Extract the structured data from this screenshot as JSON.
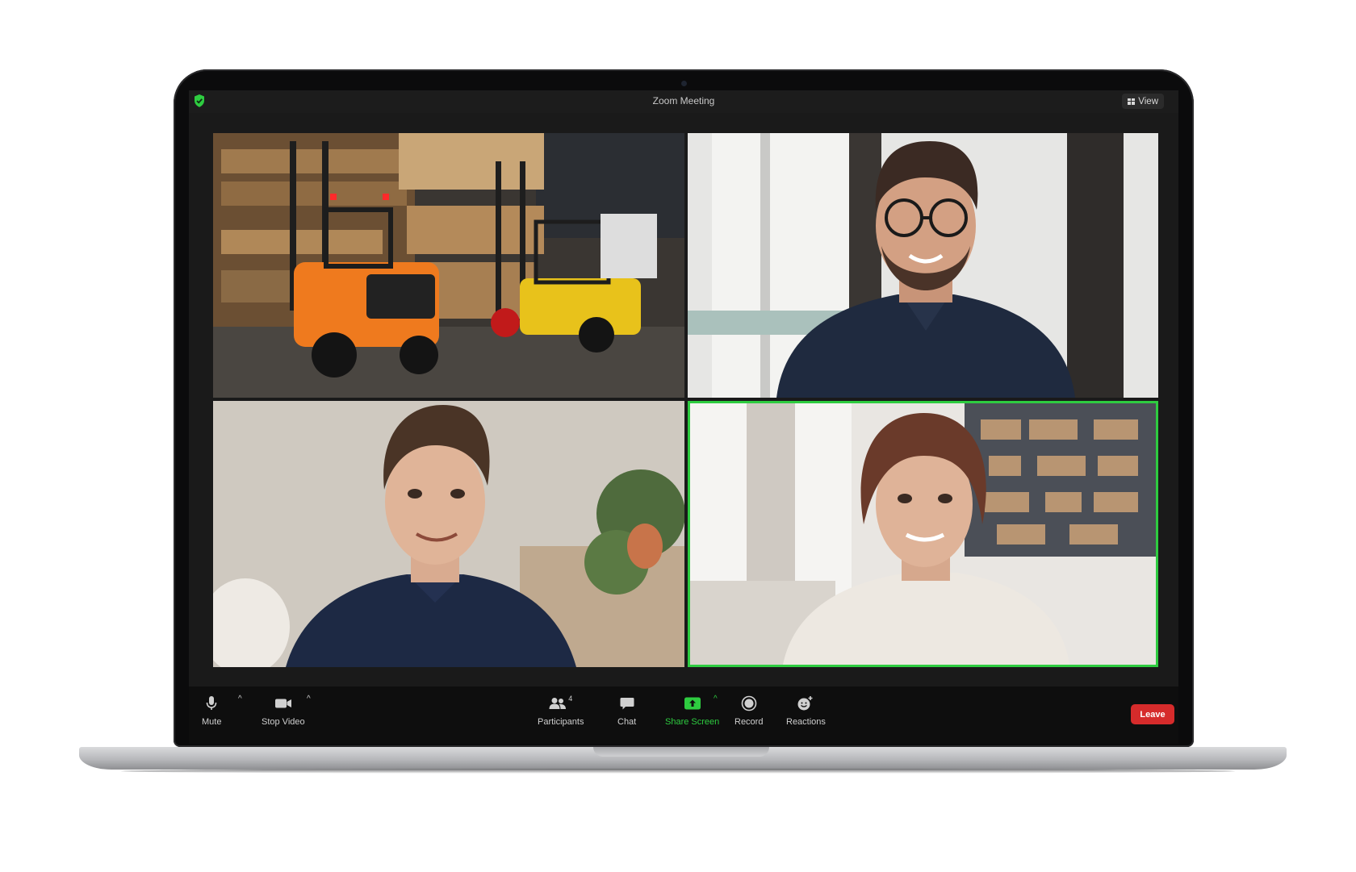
{
  "window": {
    "title": "Zoom Meeting",
    "view_label": "View"
  },
  "participants_grid": [
    {
      "name": "forklift-warehouse-feed"
    },
    {
      "name": "participant-man-glasses"
    },
    {
      "name": "participant-man-smiling"
    },
    {
      "name": "participant-woman-active-speaker"
    }
  ],
  "toolbar": {
    "mute_label": "Mute",
    "stop_video_label": "Stop Video",
    "participants_label": "Participants",
    "participants_count": "4",
    "chat_label": "Chat",
    "share_screen_label": "Share Screen",
    "record_label": "Record",
    "reactions_label": "Reactions",
    "leave_label": "Leave"
  },
  "colors": {
    "active_speaker_border": "#2ecc40",
    "share_screen": "#2ecc40",
    "leave_button": "#d62b2b",
    "security_shield": "#2ecc40"
  }
}
